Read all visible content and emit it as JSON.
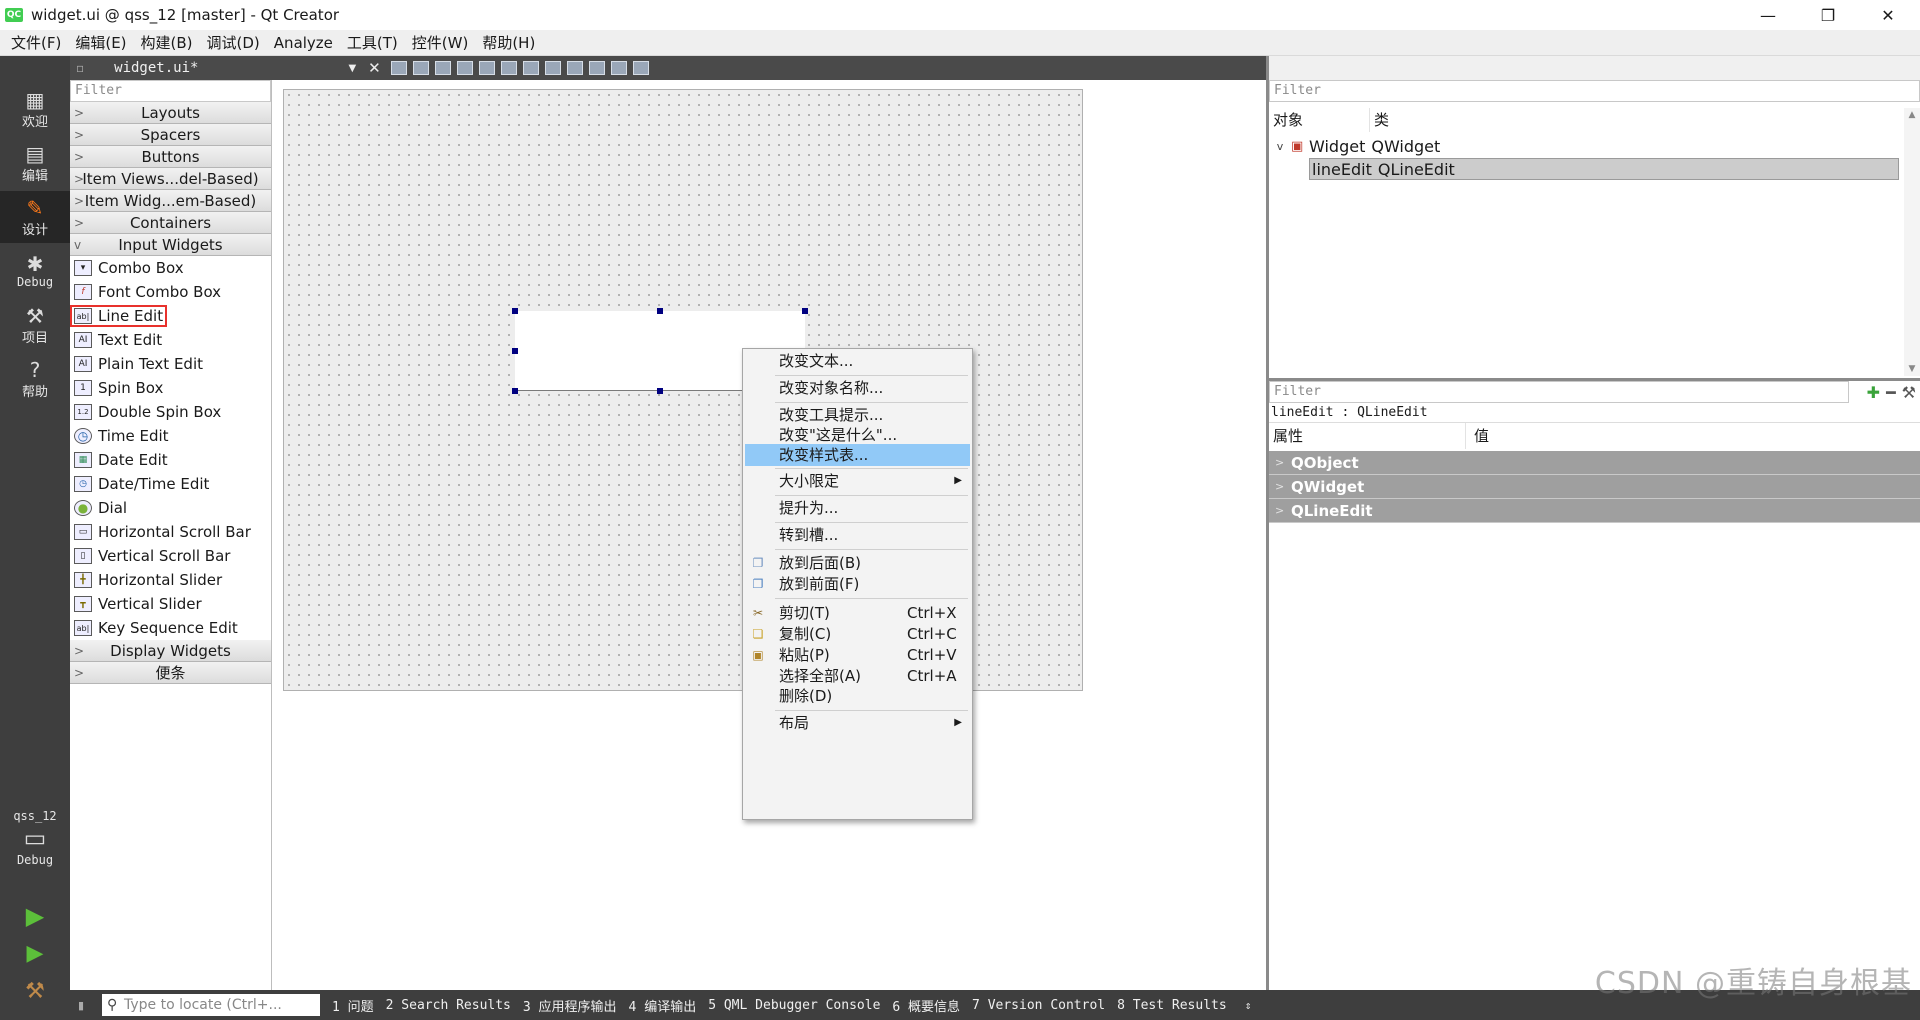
{
  "window": {
    "title": "widget.ui @ qss_12 [master] - Qt Creator",
    "logo": "QC",
    "minimize": "—",
    "restore": "❐",
    "close": "✕"
  },
  "menubar": [
    "文件(F)",
    "编辑(E)",
    "构建(B)",
    "调试(D)",
    "Analyze",
    "工具(T)",
    "控件(W)",
    "帮助(H)"
  ],
  "modes": [
    {
      "label": "欢迎",
      "icon": "grid-icon"
    },
    {
      "label": "编辑",
      "icon": "edit-doc-icon"
    },
    {
      "label": "设计",
      "icon": "pencil-icon"
    },
    {
      "label": "Debug",
      "icon": "bug-icon"
    },
    {
      "label": "项目",
      "icon": "wrench-icon"
    },
    {
      "label": "帮助",
      "icon": "help-icon"
    }
  ],
  "kit": {
    "project": "qss_12",
    "build": "Debug"
  },
  "editor": {
    "document": "widget.ui*"
  },
  "widgetbox": {
    "filter_placeholder": "Filter",
    "categories_top": [
      "Layouts",
      "Spacers",
      "Buttons",
      "Item Views...del-Based)",
      "Item Widg...em-Based)",
      "Containers",
      "Input Widgets"
    ],
    "input_widgets": [
      {
        "label": "Combo Box",
        "icon": "combo-box-icon",
        "glyph": "▾"
      },
      {
        "label": "Font Combo Box",
        "icon": "font-combo-icon",
        "glyph": "f"
      },
      {
        "label": "Line Edit",
        "icon": "line-edit-icon",
        "glyph": "ab|"
      },
      {
        "label": "Text Edit",
        "icon": "text-edit-icon",
        "glyph": "AI"
      },
      {
        "label": "Plain Text Edit",
        "icon": "plain-text-edit-icon",
        "glyph": "AI"
      },
      {
        "label": "Spin Box",
        "icon": "spin-box-icon",
        "glyph": "1"
      },
      {
        "label": "Double Spin Box",
        "icon": "double-spin-box-icon",
        "glyph": "1.2"
      },
      {
        "label": "Time Edit",
        "icon": "clock-icon",
        "glyph": "◷"
      },
      {
        "label": "Date Edit",
        "icon": "calendar-icon",
        "glyph": "▦"
      },
      {
        "label": "Date/Time Edit",
        "icon": "date-time-icon",
        "glyph": "◷"
      },
      {
        "label": "Dial",
        "icon": "dial-icon",
        "glyph": "●"
      },
      {
        "label": "Horizontal Scroll Bar",
        "icon": "hscrollbar-icon",
        "glyph": "▭"
      },
      {
        "label": "Vertical Scroll Bar",
        "icon": "vscrollbar-icon",
        "glyph": "▯"
      },
      {
        "label": "Horizontal Slider",
        "icon": "hslider-icon",
        "glyph": "╋"
      },
      {
        "label": "Vertical Slider",
        "icon": "vslider-icon",
        "glyph": "┳"
      },
      {
        "label": "Key Sequence Edit",
        "icon": "key-sequence-icon",
        "glyph": "ab|"
      }
    ],
    "categories_bottom": [
      "Display Widgets",
      "便条"
    ]
  },
  "context_menu": {
    "items": [
      {
        "label": "改变文本..."
      },
      {
        "label": "改变对象名称..."
      },
      {
        "label": "改变工具提示..."
      },
      {
        "label": "改变\"这是什么\"..."
      },
      {
        "label": "改变样式表..."
      },
      {
        "label": "大小限定"
      },
      {
        "label": "提升为..."
      },
      {
        "label": "转到槽..."
      },
      {
        "label": "放到后面(B)"
      },
      {
        "label": "放到前面(F)"
      },
      {
        "label": "剪切(T)",
        "shortcut": "Ctrl+X"
      },
      {
        "label": "复制(C)",
        "shortcut": "Ctrl+C"
      },
      {
        "label": "粘贴(P)",
        "shortcut": "Ctrl+V"
      },
      {
        "label": "选择全部(A)",
        "shortcut": "Ctrl+A"
      },
      {
        "label": "删除(D)"
      },
      {
        "label": "布局"
      }
    ]
  },
  "object_inspector": {
    "filter_placeholder": "Filter",
    "col_object": "对象",
    "col_class": "类",
    "rows": [
      {
        "object": "Widget",
        "class": "QWidget"
      },
      {
        "object": "lineEdit",
        "class": "QLineEdit"
      }
    ]
  },
  "property_editor": {
    "filter_placeholder": "Filter",
    "current": "lineEdit : QLineEdit",
    "col_property": "属性",
    "col_value": "值",
    "groups": [
      "QObject",
      "QWidget",
      "QLineEdit"
    ]
  },
  "statusbar": {
    "locate_placeholder": "Type to locate (Ctrl+...",
    "panes": [
      "1 问题",
      "2 Search Results",
      "3 应用程序输出",
      "4 编译输出",
      "5 QML Debugger Console",
      "6 概要信息",
      "7 Version Control",
      "8 Test Results"
    ]
  },
  "watermark": "CSDN @重铸自身根基",
  "colors": {
    "highlight": "#91c9f7",
    "handle": "#000080",
    "mode_bar": "#3e3e3e",
    "selection_box": "#e8312c"
  }
}
